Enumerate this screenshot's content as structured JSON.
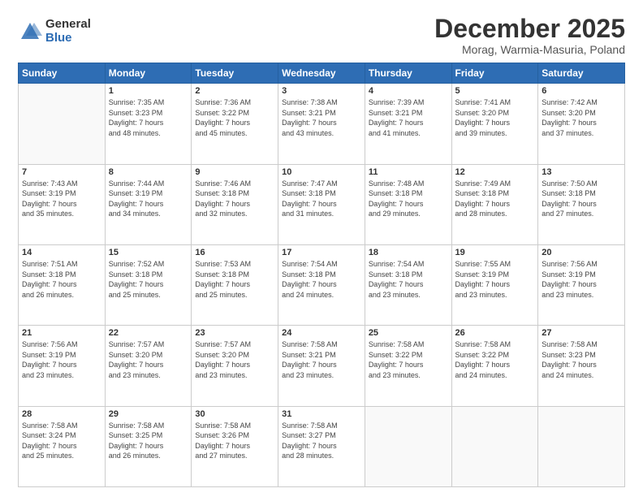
{
  "logo": {
    "general": "General",
    "blue": "Blue"
  },
  "title": "December 2025",
  "subtitle": "Morag, Warmia-Masuria, Poland",
  "days_header": [
    "Sunday",
    "Monday",
    "Tuesday",
    "Wednesday",
    "Thursday",
    "Friday",
    "Saturday"
  ],
  "weeks": [
    [
      {
        "num": "",
        "info": ""
      },
      {
        "num": "1",
        "info": "Sunrise: 7:35 AM\nSunset: 3:23 PM\nDaylight: 7 hours\nand 48 minutes."
      },
      {
        "num": "2",
        "info": "Sunrise: 7:36 AM\nSunset: 3:22 PM\nDaylight: 7 hours\nand 45 minutes."
      },
      {
        "num": "3",
        "info": "Sunrise: 7:38 AM\nSunset: 3:21 PM\nDaylight: 7 hours\nand 43 minutes."
      },
      {
        "num": "4",
        "info": "Sunrise: 7:39 AM\nSunset: 3:21 PM\nDaylight: 7 hours\nand 41 minutes."
      },
      {
        "num": "5",
        "info": "Sunrise: 7:41 AM\nSunset: 3:20 PM\nDaylight: 7 hours\nand 39 minutes."
      },
      {
        "num": "6",
        "info": "Sunrise: 7:42 AM\nSunset: 3:20 PM\nDaylight: 7 hours\nand 37 minutes."
      }
    ],
    [
      {
        "num": "7",
        "info": "Sunrise: 7:43 AM\nSunset: 3:19 PM\nDaylight: 7 hours\nand 35 minutes."
      },
      {
        "num": "8",
        "info": "Sunrise: 7:44 AM\nSunset: 3:19 PM\nDaylight: 7 hours\nand 34 minutes."
      },
      {
        "num": "9",
        "info": "Sunrise: 7:46 AM\nSunset: 3:18 PM\nDaylight: 7 hours\nand 32 minutes."
      },
      {
        "num": "10",
        "info": "Sunrise: 7:47 AM\nSunset: 3:18 PM\nDaylight: 7 hours\nand 31 minutes."
      },
      {
        "num": "11",
        "info": "Sunrise: 7:48 AM\nSunset: 3:18 PM\nDaylight: 7 hours\nand 29 minutes."
      },
      {
        "num": "12",
        "info": "Sunrise: 7:49 AM\nSunset: 3:18 PM\nDaylight: 7 hours\nand 28 minutes."
      },
      {
        "num": "13",
        "info": "Sunrise: 7:50 AM\nSunset: 3:18 PM\nDaylight: 7 hours\nand 27 minutes."
      }
    ],
    [
      {
        "num": "14",
        "info": "Sunrise: 7:51 AM\nSunset: 3:18 PM\nDaylight: 7 hours\nand 26 minutes."
      },
      {
        "num": "15",
        "info": "Sunrise: 7:52 AM\nSunset: 3:18 PM\nDaylight: 7 hours\nand 25 minutes."
      },
      {
        "num": "16",
        "info": "Sunrise: 7:53 AM\nSunset: 3:18 PM\nDaylight: 7 hours\nand 25 minutes."
      },
      {
        "num": "17",
        "info": "Sunrise: 7:54 AM\nSunset: 3:18 PM\nDaylight: 7 hours\nand 24 minutes."
      },
      {
        "num": "18",
        "info": "Sunrise: 7:54 AM\nSunset: 3:18 PM\nDaylight: 7 hours\nand 23 minutes."
      },
      {
        "num": "19",
        "info": "Sunrise: 7:55 AM\nSunset: 3:19 PM\nDaylight: 7 hours\nand 23 minutes."
      },
      {
        "num": "20",
        "info": "Sunrise: 7:56 AM\nSunset: 3:19 PM\nDaylight: 7 hours\nand 23 minutes."
      }
    ],
    [
      {
        "num": "21",
        "info": "Sunrise: 7:56 AM\nSunset: 3:19 PM\nDaylight: 7 hours\nand 23 minutes."
      },
      {
        "num": "22",
        "info": "Sunrise: 7:57 AM\nSunset: 3:20 PM\nDaylight: 7 hours\nand 23 minutes."
      },
      {
        "num": "23",
        "info": "Sunrise: 7:57 AM\nSunset: 3:20 PM\nDaylight: 7 hours\nand 23 minutes."
      },
      {
        "num": "24",
        "info": "Sunrise: 7:58 AM\nSunset: 3:21 PM\nDaylight: 7 hours\nand 23 minutes."
      },
      {
        "num": "25",
        "info": "Sunrise: 7:58 AM\nSunset: 3:22 PM\nDaylight: 7 hours\nand 23 minutes."
      },
      {
        "num": "26",
        "info": "Sunrise: 7:58 AM\nSunset: 3:22 PM\nDaylight: 7 hours\nand 24 minutes."
      },
      {
        "num": "27",
        "info": "Sunrise: 7:58 AM\nSunset: 3:23 PM\nDaylight: 7 hours\nand 24 minutes."
      }
    ],
    [
      {
        "num": "28",
        "info": "Sunrise: 7:58 AM\nSunset: 3:24 PM\nDaylight: 7 hours\nand 25 minutes."
      },
      {
        "num": "29",
        "info": "Sunrise: 7:58 AM\nSunset: 3:25 PM\nDaylight: 7 hours\nand 26 minutes."
      },
      {
        "num": "30",
        "info": "Sunrise: 7:58 AM\nSunset: 3:26 PM\nDaylight: 7 hours\nand 27 minutes."
      },
      {
        "num": "31",
        "info": "Sunrise: 7:58 AM\nSunset: 3:27 PM\nDaylight: 7 hours\nand 28 minutes."
      },
      {
        "num": "",
        "info": ""
      },
      {
        "num": "",
        "info": ""
      },
      {
        "num": "",
        "info": ""
      }
    ]
  ]
}
